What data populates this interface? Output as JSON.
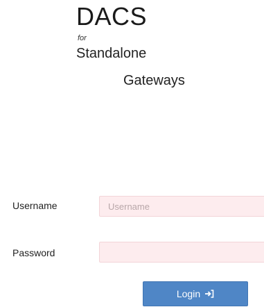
{
  "brand": {
    "title": "DACS",
    "for": "for",
    "line1": "Standalone",
    "line2": "Gateways"
  },
  "form": {
    "username": {
      "label": "Username",
      "placeholder": "Username",
      "value": ""
    },
    "password": {
      "label": "Password",
      "placeholder": "",
      "value": ""
    },
    "login_button": {
      "label": "Login",
      "icon": "sign-in-icon"
    }
  },
  "colors": {
    "input_background": "#fdecee",
    "button_background": "#4f86c6"
  }
}
